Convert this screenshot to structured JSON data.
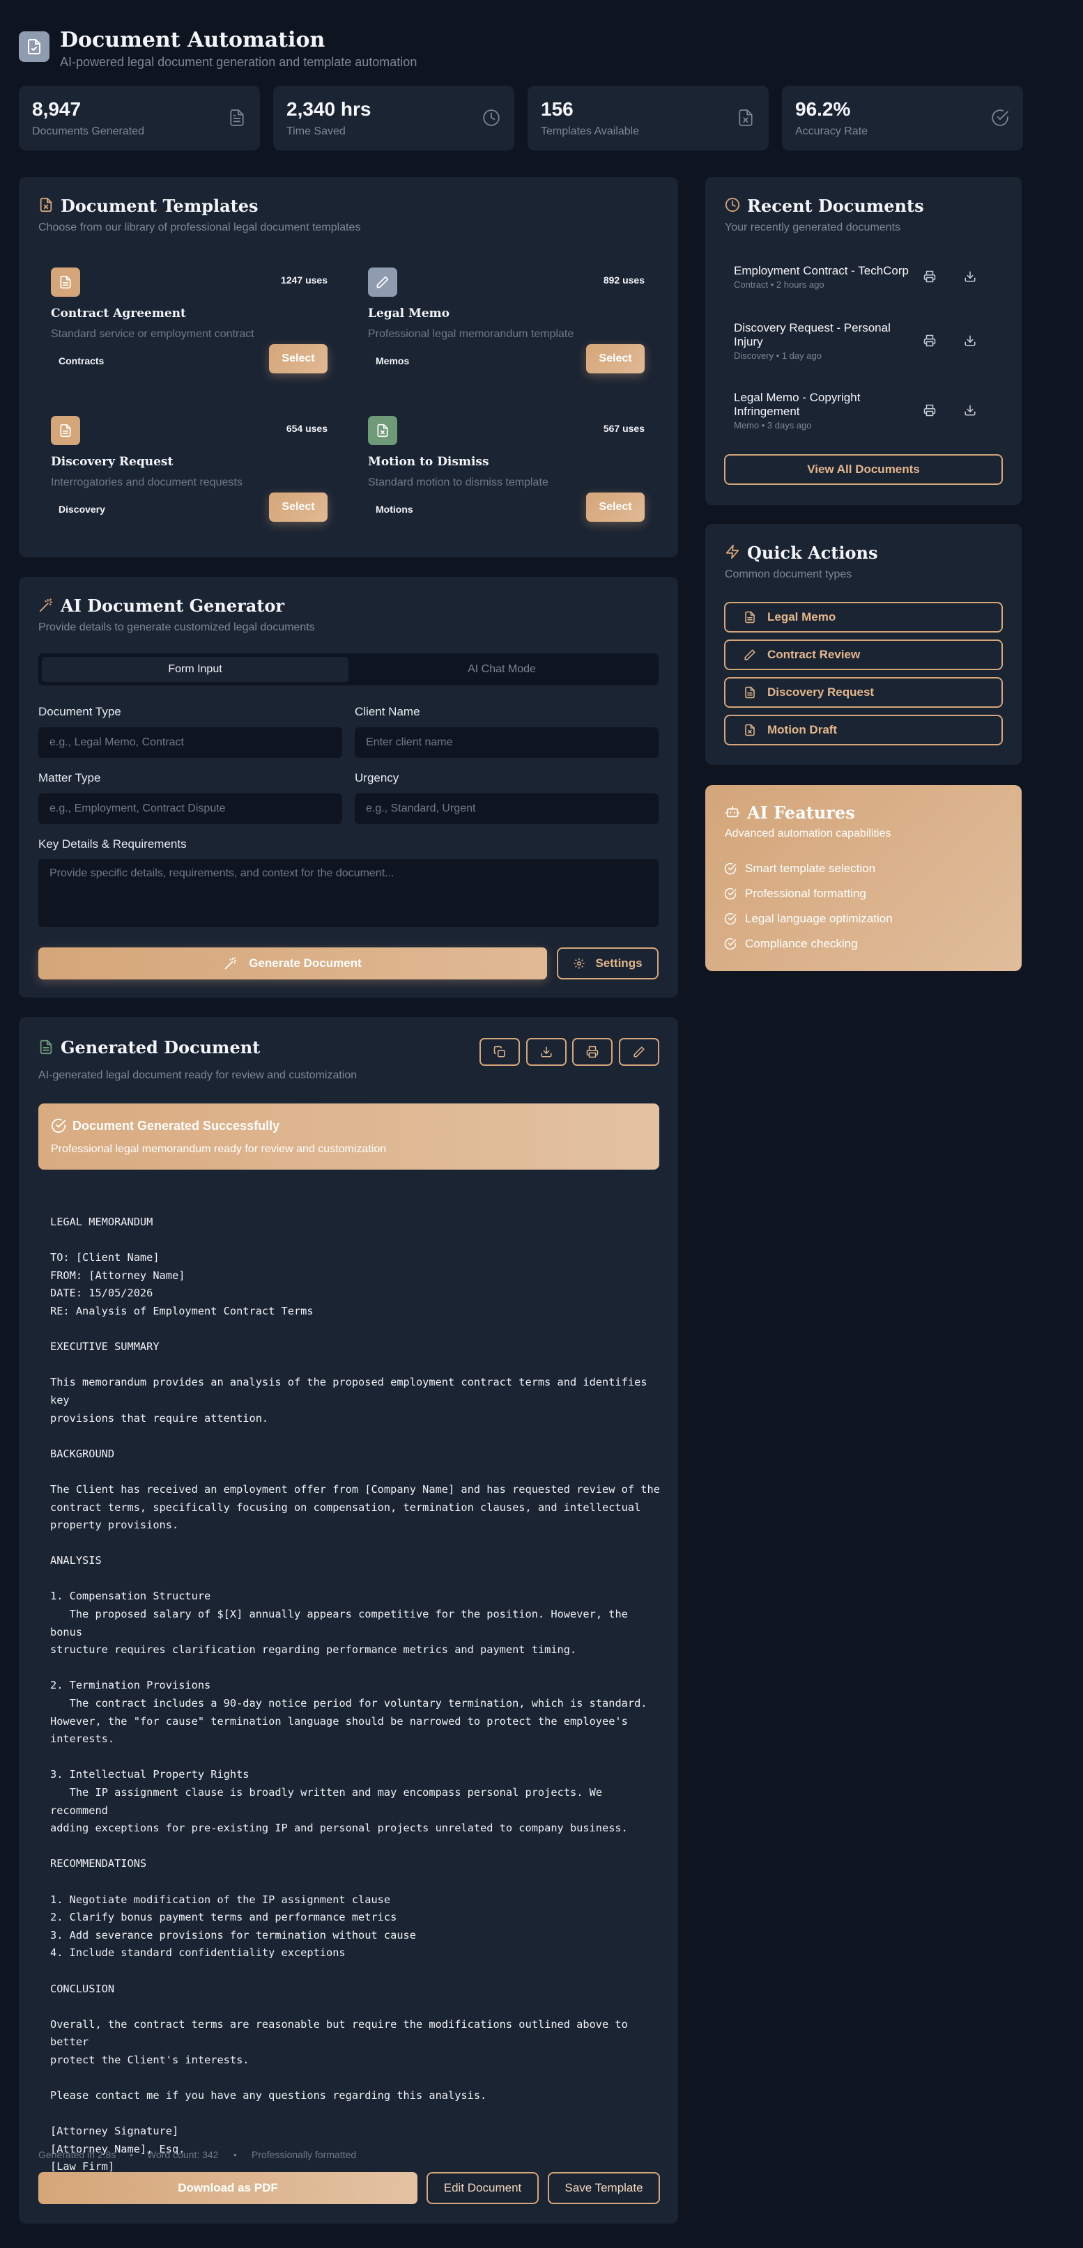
{
  "header": {
    "title": "Document Automation",
    "subtitle": "AI-powered legal document generation and template automation",
    "icon": "document-check-icon"
  },
  "stats": [
    {
      "value": "8,947",
      "label": "Documents Generated",
      "icon": "document-icon"
    },
    {
      "value": "2,340 hrs",
      "label": "Time Saved",
      "icon": "clock-icon"
    },
    {
      "value": "156",
      "label": "Templates Available",
      "icon": "file-x-icon"
    },
    {
      "value": "96.2%",
      "label": "Accuracy Rate",
      "icon": "check-circle-icon"
    }
  ],
  "templates": {
    "title": "Document Templates",
    "subtitle": "Choose from our library of professional legal document templates",
    "select_label": "Select",
    "items": [
      {
        "name": "Contract Agreement",
        "desc": "Standard service or employment contract",
        "uses": "1247 uses",
        "category": "Contracts",
        "icon": "document-icon",
        "color": "#d5a679"
      },
      {
        "name": "Legal Memo",
        "desc": "Professional legal memorandum template",
        "uses": "892 uses",
        "category": "Memos",
        "icon": "pen-icon",
        "color": "#8f9cb0"
      },
      {
        "name": "Discovery Request",
        "desc": "Interrogatories and document requests",
        "uses": "654 uses",
        "category": "Discovery",
        "icon": "document-icon",
        "color": "#d5a679"
      },
      {
        "name": "Motion to Dismiss",
        "desc": "Standard motion to dismiss template",
        "uses": "567 uses",
        "category": "Motions",
        "icon": "file-x-icon",
        "color": "#6f9a78"
      }
    ]
  },
  "recent": {
    "title": "Recent Documents",
    "subtitle": "Your recently generated documents",
    "items": [
      {
        "title": "Employment Contract - TechCorp",
        "meta": "Contract • 2 hours ago"
      },
      {
        "title": "Discovery Request - Personal Injury",
        "meta": "Discovery • 1 day ago"
      },
      {
        "title": "Legal Memo - Copyright Infringement",
        "meta": "Memo • 3 days ago"
      }
    ],
    "view_all": "View All Documents"
  },
  "quick_actions": {
    "title": "Quick Actions",
    "subtitle": "Common document types",
    "items": [
      {
        "label": "Legal Memo",
        "icon": "document-icon"
      },
      {
        "label": "Contract Review",
        "icon": "pen-icon"
      },
      {
        "label": "Discovery Request",
        "icon": "document-icon"
      },
      {
        "label": "Motion Draft",
        "icon": "file-x-icon"
      }
    ]
  },
  "features": {
    "title": "AI Features",
    "subtitle": "Advanced automation capabilities",
    "items": [
      "Smart template selection",
      "Professional formatting",
      "Legal language optimization",
      "Compliance checking"
    ]
  },
  "generator": {
    "title": "AI Document Generator",
    "subtitle": "Provide details to generate customized legal documents",
    "tabs": [
      "Form Input",
      "AI Chat Mode"
    ],
    "active_tab": "Form Input",
    "fields": {
      "document_type": {
        "label": "Document Type",
        "placeholder": "e.g., Legal Memo, Contract"
      },
      "client_name": {
        "label": "Client Name",
        "placeholder": "Enter client name"
      },
      "matter_type": {
        "label": "Matter Type",
        "placeholder": "e.g., Employment, Contract Dispute"
      },
      "urgency": {
        "label": "Urgency",
        "placeholder": "e.g., Standard, Urgent"
      },
      "key_details": {
        "label": "Key Details & Requirements",
        "placeholder": "Provide specific details, requirements, and context for the document..."
      }
    },
    "generate_label": "Generate Document",
    "settings_label": "Settings"
  },
  "generated": {
    "title": "Generated Document",
    "subtitle": "AI-generated legal document ready for review and customization",
    "toolbar_icons": [
      "copy-icon",
      "download-icon",
      "print-icon",
      "edit-icon"
    ],
    "success_title": "Document Generated Successfully",
    "success_sub": "Professional legal memorandum ready for review and customization",
    "body": "LEGAL MEMORANDUM\n\nTO: [Client Name]\nFROM: [Attorney Name]\nDATE: 15/05/2026\nRE: Analysis of Employment Contract Terms\n\nEXECUTIVE SUMMARY\n\nThis memorandum provides an analysis of the proposed employment contract terms and identifies key\nprovisions that require attention.\n\nBACKGROUND\n\nThe Client has received an employment offer from [Company Name] and has requested review of the\ncontract terms, specifically focusing on compensation, termination clauses, and intellectual\nproperty provisions.\n\nANALYSIS\n\n1. Compensation Structure\n   The proposed salary of $[X] annually appears competitive for the position. However, the bonus\nstructure requires clarification regarding performance metrics and payment timing.\n\n2. Termination Provisions\n   The contract includes a 90-day notice period for voluntary termination, which is standard.\nHowever, the \"for cause\" termination language should be narrowed to protect the employee's\ninterests.\n\n3. Intellectual Property Rights\n   The IP assignment clause is broadly written and may encompass personal projects. We recommend\nadding exceptions for pre-existing IP and personal projects unrelated to company business.\n\nRECOMMENDATIONS\n\n1. Negotiate modification of the IP assignment clause\n2. Clarify bonus payment terms and performance metrics\n3. Add severance provisions for termination without cause\n4. Include standard confidentiality exceptions\n\nCONCLUSION\n\nOverall, the contract terms are reasonable but require the modifications outlined above to better\nprotect the Client's interests.\n\nPlease contact me if you have any questions regarding this analysis.\n\n[Attorney Signature]\n[Attorney Name], Esq.\n[Law Firm]",
    "footer": {
      "generated": "Generated in 2.8s",
      "word_count": "Word count: 342",
      "formatted": "Professionally formatted",
      "sep": "•"
    },
    "download_label": "Download as PDF",
    "edit_label": "Edit Document",
    "save_label": "Save Template"
  },
  "colors": {
    "accent": "#d5a679",
    "background": "#0f1520",
    "card": "#1b2433"
  }
}
